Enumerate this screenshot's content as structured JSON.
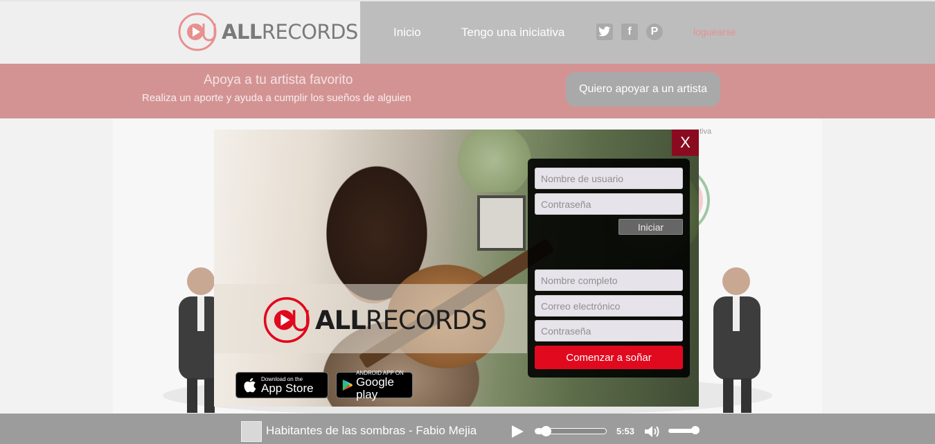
{
  "header": {
    "logo_text_bold": "ALL",
    "logo_text_light": "RECORDS",
    "nav": [
      {
        "label": "Inicio"
      },
      {
        "label": "Tengo una iniciativa"
      }
    ],
    "social": [
      {
        "name": "twitter",
        "glyph": "t"
      },
      {
        "name": "facebook",
        "glyph": "f"
      },
      {
        "name": "pinterest",
        "glyph": "P"
      }
    ],
    "login_label": "loguearse"
  },
  "banner": {
    "title": "Apoya a tu artista favorito",
    "subtitle": "Realiza un aporte y ayuda a cumplir los sueños de alguien",
    "button_label": "Quiero apoyar a un artista"
  },
  "background": {
    "partial_text": "tiva"
  },
  "modal": {
    "close_label": "X",
    "logo_text_bold": "ALL",
    "logo_text_light": "RECORDS",
    "login_form": {
      "username_placeholder": "Nombre de usuario",
      "password_placeholder": "Contraseña",
      "submit_label": "Iniciar"
    },
    "register_form": {
      "fullname_placeholder": "Nombre completo",
      "email_placeholder": "Correo electrónico",
      "password_placeholder": "Contraseña",
      "submit_label": "Comenzar a soñar"
    },
    "stores": [
      {
        "small": "Download on the",
        "big": "App Store",
        "icon": "apple-icon"
      },
      {
        "small": "ANDROID APP ON",
        "big": "Google play",
        "icon": "google-play-icon"
      }
    ]
  },
  "player": {
    "track": "Habitantes de las sombras - Fabio Mejia",
    "time": "5:53",
    "progress_fraction": 0.1,
    "volume_fraction": 0.9
  },
  "colors": {
    "brand_red": "#e0091e",
    "banner_pink": "#d49393",
    "close_dark_red": "#8a0b1f"
  }
}
